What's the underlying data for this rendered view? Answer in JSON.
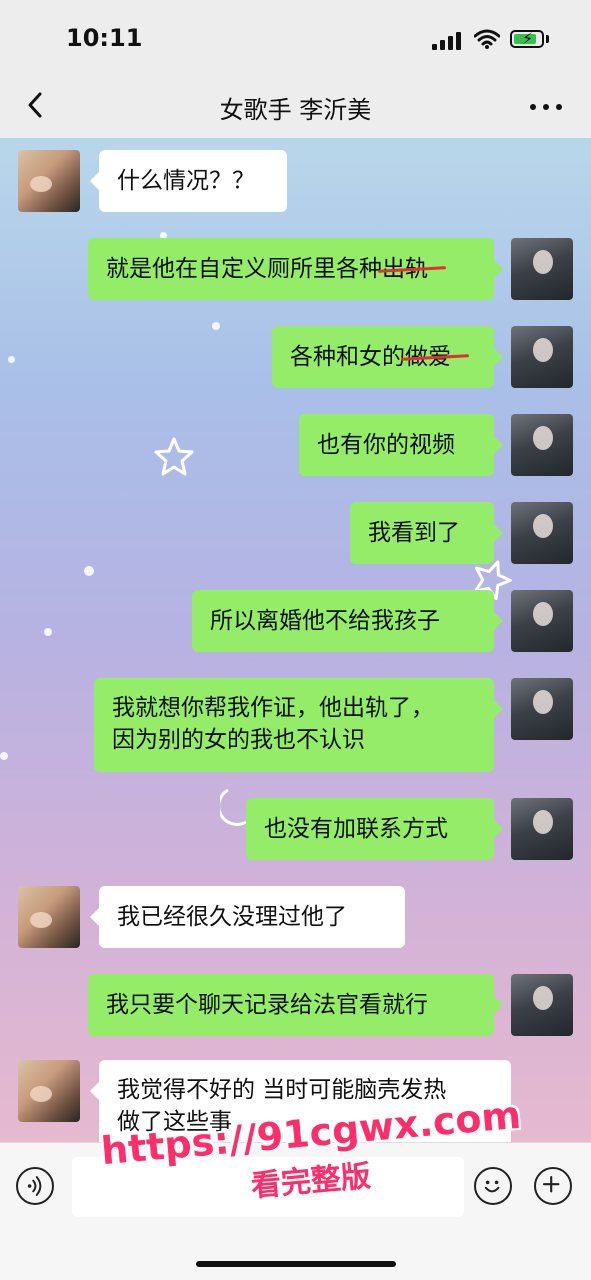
{
  "status": {
    "time": "10:11"
  },
  "nav": {
    "title": "女歌手 李沂美"
  },
  "messages": [
    {
      "side": "left",
      "text": "什么情况？？"
    },
    {
      "side": "right",
      "text": "就是他在自定义厕所里各种",
      "strike_text": "出轨"
    },
    {
      "side": "right",
      "text": "各种和女的",
      "strike_text": "做爱"
    },
    {
      "side": "right",
      "text": "也有你的视频"
    },
    {
      "side": "right",
      "text": "我看到了"
    },
    {
      "side": "right",
      "text": "所以离婚他不给我孩子"
    },
    {
      "side": "right",
      "line1": "我就想你帮我作证，他出轨了，",
      "line2": "因为别的女的我也不认识"
    },
    {
      "side": "right",
      "text": "也没有加联系方式"
    },
    {
      "side": "left",
      "text": "我已经很久没理过他了"
    },
    {
      "side": "right",
      "text": "我只要个聊天记录给法官看就行"
    },
    {
      "side": "left",
      "line1": "我觉得不好的 当时可能脑壳发热",
      "line2": "做了这些事"
    }
  ],
  "watermark": {
    "url": "https://91cgwx.com",
    "subtitle": "看完整版"
  },
  "colors": {
    "sent_bubble": "#95ec69",
    "received_bubble": "#ffffff",
    "strike": "#e03030",
    "watermark": "#ff2d6a"
  },
  "icons": {
    "back": "chevron-left-icon",
    "more": "more-icon",
    "voice": "voice-icon",
    "emoji": "emoji-icon",
    "plus": "plus-icon"
  }
}
